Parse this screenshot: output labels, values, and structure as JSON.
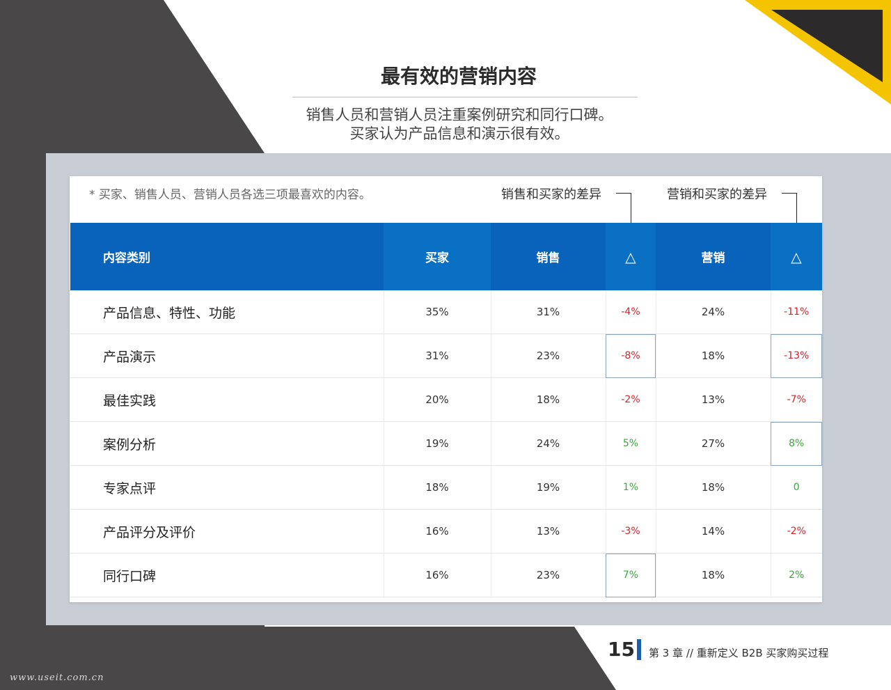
{
  "title": "最有效的营销内容",
  "subtitle_lines": [
    "销售人员和营销人员注重案例研究和同行口碑。",
    "买家认为产品信息和演示很有效。"
  ],
  "note": "* 买家、销售人员、营销人员各选三项最喜欢的内容。",
  "diff_labels": {
    "sales_vs_buyer": "销售和买家的差异",
    "marketing_vs_buyer": "营销和买家的差异"
  },
  "table": {
    "headers": [
      "内容类别",
      "买家",
      "销售",
      "△",
      "营销",
      "△"
    ],
    "rows": [
      [
        "产品信息、特性、功能",
        "35%",
        "31%",
        "-4%",
        "24%",
        "-11%"
      ],
      [
        "产品演示",
        "31%",
        "23%",
        "-8%",
        "18%",
        "-13%"
      ],
      [
        "最佳实践",
        "20%",
        "18%",
        "-2%",
        "13%",
        "-7%"
      ],
      [
        "案例分析",
        "19%",
        "24%",
        "5%",
        "27%",
        "8%"
      ],
      [
        "专家点评",
        "18%",
        "19%",
        "1%",
        "18%",
        "0"
      ],
      [
        "产品评分及评价",
        "16%",
        "13%",
        "-3%",
        "14%",
        "-2%"
      ],
      [
        "同行口碑",
        "16%",
        "23%",
        "7%",
        "18%",
        "2%"
      ]
    ]
  },
  "footer": {
    "page": "15",
    "chapter": "第 3 章 // 重新定义 B2B 买家购买过程"
  },
  "watermark": "www.useit.com.cn",
  "colors": {
    "header_blue": "#0a63ba",
    "negative": "#d0232a",
    "positive": "#3aa83a",
    "accent_yellow": "#f5c400"
  }
}
